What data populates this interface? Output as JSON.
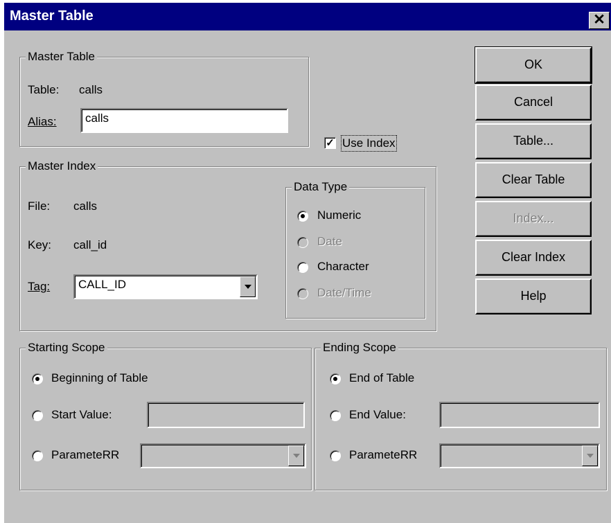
{
  "window": {
    "title": "Master Table",
    "close_label": "✕"
  },
  "master_table": {
    "legend": "Master Table",
    "table_label": "Table:",
    "table_value": "calls",
    "alias_label": "Alias:",
    "alias_value": "calls"
  },
  "use_index": {
    "label": "Use Index",
    "checked": true
  },
  "master_index": {
    "legend": "Master Index",
    "file_label": "File:",
    "file_value": "calls",
    "key_label": "Key:",
    "key_value": "call_id",
    "tag_label": "Tag:",
    "tag_value": "CALL_ID"
  },
  "data_type": {
    "legend": "Data Type",
    "options": [
      {
        "label": "Numeric",
        "selected": true,
        "enabled": true
      },
      {
        "label": "Date",
        "selected": false,
        "enabled": false
      },
      {
        "label": "Character",
        "selected": false,
        "enabled": true
      },
      {
        "label": "Date/Time",
        "selected": false,
        "enabled": false
      }
    ]
  },
  "buttons": {
    "ok": "OK",
    "cancel": "Cancel",
    "table": "Table...",
    "clear_table": "Clear Table",
    "index": "Index...",
    "clear_index": "Clear Index",
    "help": "Help"
  },
  "starting_scope": {
    "legend": "Starting Scope",
    "beginning": "Beginning of Table",
    "start_value": "Start Value:",
    "parameter": "ParameteRR",
    "selected": "beginning"
  },
  "ending_scope": {
    "legend": "Ending Scope",
    "end": "End of Table",
    "end_value": "End Value:",
    "parameter": "ParameteRR",
    "selected": "end"
  }
}
